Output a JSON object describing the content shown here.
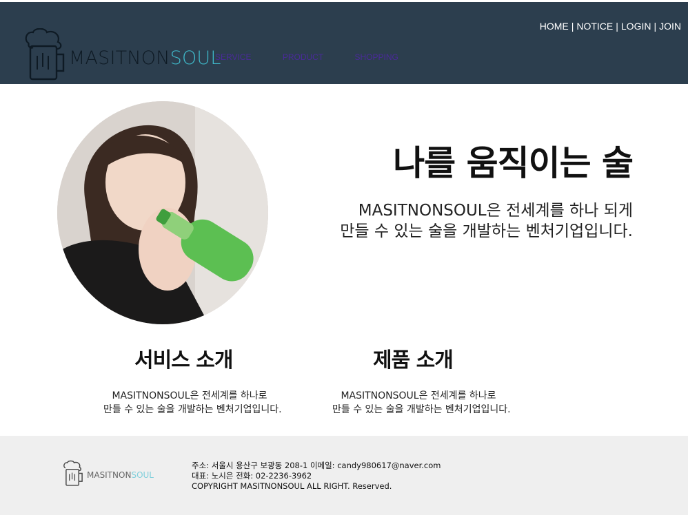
{
  "header": {
    "top_links": [
      "HOME",
      "NOTICE",
      "LOGIN",
      "JOIN"
    ],
    "separator": "|",
    "logo": {
      "part1": "MASITNON",
      "part2": "SOUL",
      "icon": "beer-mug-icon"
    },
    "nav": [
      "SERVICE",
      "PRODUCT",
      "SHOPPING"
    ],
    "bg_color": "#2c3e4e"
  },
  "hero": {
    "photo": "person-drinking-bottle-photo",
    "headline": "나를 움직이는 술",
    "intro_line1": "MASITNONSOUL은 전세계를 하나 되게",
    "intro_line2": "만들 수 있는 술을 개발하는 벤처기업입니다."
  },
  "cards": [
    {
      "title": "서비스 소개",
      "line1": "MASITNONSOUL은 전세계를 하나로",
      "line2": "만들 수 있는 술을 개발하는 벤처기업입니다."
    },
    {
      "title": "제품 소개",
      "line1": "MASITNONSOUL은 전세계를 하나로",
      "line2": "만들 수 있는 술을 개발하는 벤처기업입니다."
    }
  ],
  "footer": {
    "logo": {
      "part1": "MASITNON",
      "part2": "SOUL"
    },
    "address": "주소: 서울시 용산구 보광동 208-1   이메일: candy980617@naver.com",
    "rep": "대표: 노시은     전화: 02-2236-3962",
    "copyright": "COPYRIGHT MASITNONSOUL ALL RIGHT. Reserved."
  }
}
